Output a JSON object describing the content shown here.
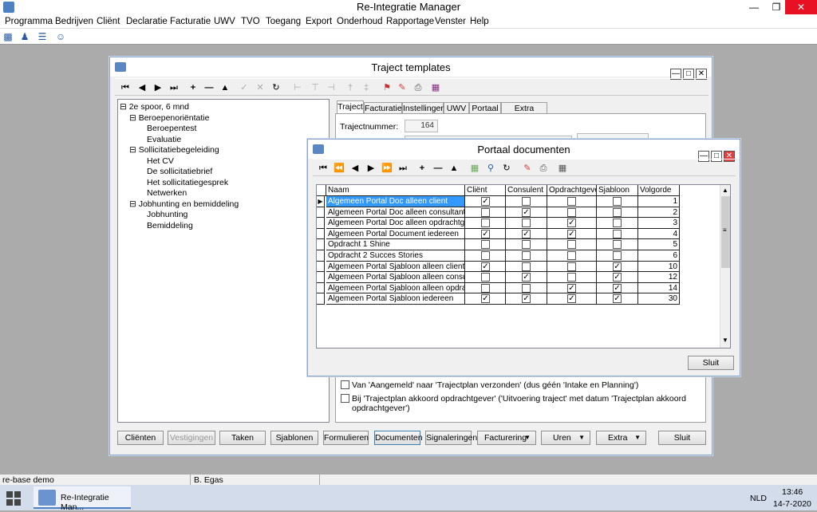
{
  "app": {
    "title": "Re-Integratie Manager"
  },
  "menu": [
    "Programma",
    "Bedrijven",
    "Cliënt",
    "Declaratie",
    "Facturatie",
    "UWV",
    "TVO",
    "Toegang",
    "Export",
    "Onderhoud",
    "Rapportage",
    "Venster",
    "Help"
  ],
  "traject_window": {
    "title": "Traject templates",
    "tree": [
      {
        "label": "2e spoor, 6 mnd",
        "level": 0
      },
      {
        "label": "Beroepenoriëntatie",
        "level": 1
      },
      {
        "label": "Beroepentest",
        "level": 2
      },
      {
        "label": "Evaluatie",
        "level": 2
      },
      {
        "label": "Sollicitatiebegeleiding",
        "level": 1
      },
      {
        "label": "Het CV",
        "level": 2
      },
      {
        "label": "De sollicitatiebrief",
        "level": 2
      },
      {
        "label": "Het sollicitatiegesprek",
        "level": 2
      },
      {
        "label": "Netwerken",
        "level": 2
      },
      {
        "label": "Jobhunting en bemiddeling",
        "level": 1
      },
      {
        "label": "Jobhunting",
        "level": 2
      },
      {
        "label": "Bemiddeling",
        "level": 2
      }
    ],
    "tabs": [
      "Traject",
      "Facturatie",
      "Instellingen",
      "UWV",
      "Portaal",
      "Extra velden"
    ],
    "trajectnummer_label": "Trajectnummer:",
    "trajectnummer_value": "164",
    "checkbox_1": "Van 'Aangemeld' naar 'Trajectplan verzonden' (dus géén 'Intake en Planning')",
    "checkbox_2": "Bij 'Trajectplan akkoord opdrachtgever' ('Uitvoering traject' met datum 'Trajectplan akkoord opdrachtgever')",
    "buttons": [
      "Cliënten",
      "Vestigingen",
      "Taken",
      "Sjablonen",
      "Formulieren",
      "Documenten",
      "Signaleringen",
      "Facturering",
      "Uren",
      "Extra",
      "Sluit"
    ]
  },
  "portaal_window": {
    "title": "Portaal documenten",
    "columns": [
      "Naam",
      "Cliënt",
      "Consulent",
      "Opdrachtgever",
      "Sjabloon",
      "Volgorde"
    ],
    "rows": [
      {
        "naam": "Algemeen Portal  Doc alleen client",
        "client": true,
        "consulent": false,
        "opdrachtgever": false,
        "sjabloon": false,
        "volgorde": "1"
      },
      {
        "naam": "Algemeen Portal  Doc alleen consultant en du",
        "client": false,
        "consulent": true,
        "opdrachtgever": false,
        "sjabloon": false,
        "volgorde": "2"
      },
      {
        "naam": "Algemeen Portal  Doc alleen opdrachtgever",
        "client": false,
        "consulent": false,
        "opdrachtgever": true,
        "sjabloon": false,
        "volgorde": "3"
      },
      {
        "naam": "Algemeen Portal  Document iedereen",
        "client": true,
        "consulent": true,
        "opdrachtgever": true,
        "sjabloon": false,
        "volgorde": "4"
      },
      {
        "naam": "Opdracht 1 Shine",
        "client": false,
        "consulent": false,
        "opdrachtgever": false,
        "sjabloon": false,
        "volgorde": "5"
      },
      {
        "naam": "Opdracht 2 Succes Stories",
        "client": false,
        "consulent": false,
        "opdrachtgever": false,
        "sjabloon": false,
        "volgorde": "6"
      },
      {
        "naam": "Algemeen Portal  Sjabloon alleen client",
        "client": true,
        "consulent": false,
        "opdrachtgever": false,
        "sjabloon": true,
        "volgorde": "10"
      },
      {
        "naam": "Algemeen Portal  Sjabloon alleen consultant",
        "client": false,
        "consulent": true,
        "opdrachtgever": false,
        "sjabloon": true,
        "volgorde": "12"
      },
      {
        "naam": "Algemeen Portal  Sjabloon alleen opdrachtge",
        "client": false,
        "consulent": false,
        "opdrachtgever": true,
        "sjabloon": true,
        "volgorde": "14"
      },
      {
        "naam": "Algemeen Portal Sjabloon iedereen",
        "client": true,
        "consulent": true,
        "opdrachtgever": true,
        "sjabloon": true,
        "volgorde": "30"
      }
    ],
    "sluit_label": "Sluit"
  },
  "status": {
    "left": "re-base demo",
    "user": "B. Egas"
  },
  "taskbar": {
    "app_label": "Re-Integratie Man...",
    "lang": "NLD",
    "time": "13:46",
    "date": "14-7-2020"
  }
}
